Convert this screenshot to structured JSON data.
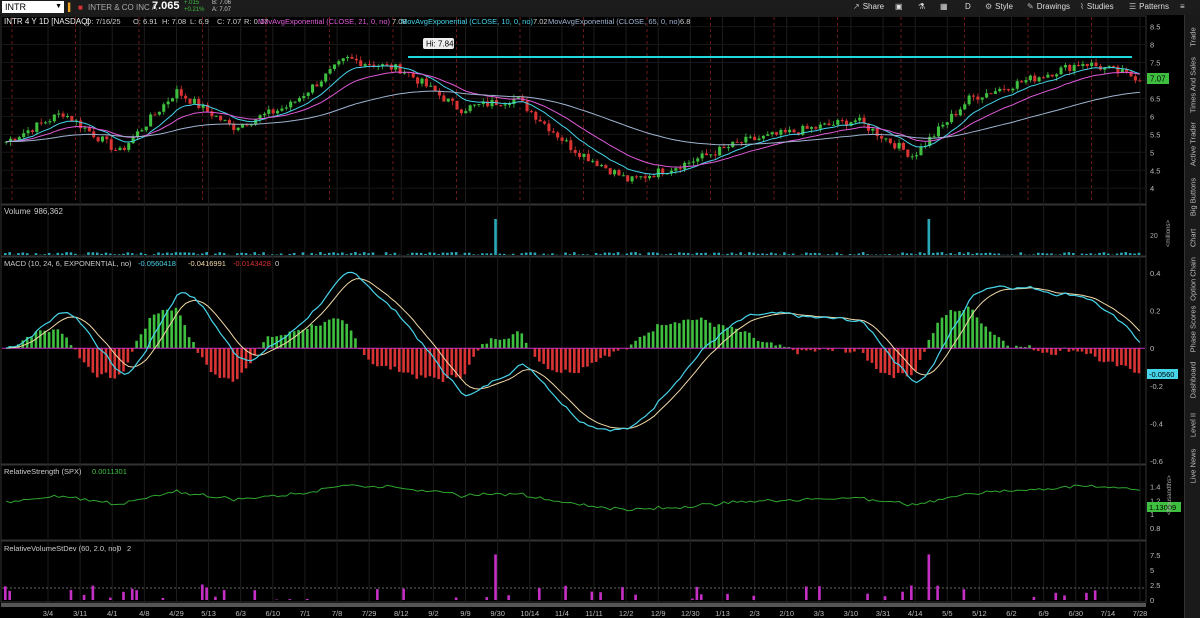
{
  "toolbar": {
    "symbol": "INTR",
    "company": "INTER & CO INC A",
    "last": "7.065",
    "change": "+.015",
    "change_pct": "+0.21%",
    "bid": "B: 7.06",
    "ask": "A: 7.07",
    "share": "Share",
    "aggregation": "D",
    "style": "Style",
    "drawings": "Drawings",
    "studies": "Studies",
    "patterns": "Patterns"
  },
  "header": {
    "title": "INTR 4 Y 1D [NASDAQ]",
    "ohlc": [
      "D: 7/16/25",
      "O: 6.91",
      "H: 7.08",
      "L: 6.9",
      "C: 7.07",
      "R: 0.17"
    ],
    "studies": [
      {
        "label": "MovAvgExponential (CLOSE, 21, 0, no)",
        "value": "7.08",
        "color": "#e05ad9"
      },
      {
        "label": "MovAvgExponential (CLOSE, 10, 0, no)",
        "value": "7.02",
        "color": "#46d4ea"
      },
      {
        "label": "MovAvgExponential (CLOSE, 65, 0, no)",
        "value": "6.8",
        "color": "#9fb3d1"
      }
    ]
  },
  "price_panel": {
    "hi_label": "Hi: 7.84",
    "last_tag": "7.07",
    "yticks": [
      "8.5",
      "8",
      "7.5",
      "7",
      "6.5",
      "6",
      "5.5",
      "5",
      "4.5",
      "4"
    ]
  },
  "volume_panel": {
    "label": "Volume",
    "value": "986,362",
    "ytick": "20",
    "unit": "<millions>"
  },
  "macd_panel": {
    "label": "MACD (10, 24, 6, EXPONENTIAL, no)",
    "v1": "-0.0560418",
    "v2": "-0.0416991",
    "v3": "-0.0143428",
    "v4": "0",
    "last_tag": "-0.0560",
    "yticks": [
      "0.4",
      "0.2",
      "0",
      "-0.2",
      "-0.4",
      "-0.6"
    ]
  },
  "rs_panel": {
    "label": "RelativeStrength (SPX)",
    "value": "0.0011301",
    "last_tag": "1.13009",
    "unit": "<thousandths>",
    "yticks": [
      "1.4",
      "1.2",
      "1",
      "0.8"
    ]
  },
  "rv_panel": {
    "label": "RelativeVolumeStDev (60, 2.0, no)",
    "v1": "0",
    "v2": "2",
    "yticks": [
      "7.5",
      "5",
      "2.5",
      "0"
    ]
  },
  "x_axis": [
    "3/4",
    "3/11",
    "4/1",
    "4/8",
    "4/29",
    "5/13",
    "6/3",
    "6/10",
    "7/1",
    "7/8",
    "7/29",
    "8/12",
    "9/2",
    "9/9",
    "9/30",
    "10/14",
    "11/4",
    "11/11",
    "12/2",
    "12/9",
    "12/30",
    "1/13",
    "2/3",
    "2/10",
    "3/3",
    "3/10",
    "3/31",
    "4/14",
    "5/5",
    "5/12",
    "6/2",
    "6/9",
    "6/30",
    "7/14",
    "7/28"
  ],
  "right_tabs": [
    "Trade",
    "Times And Sales",
    "Active Trader",
    "Big Buttons",
    "Chart",
    "Option Chain",
    "Phase Scores",
    "Dashboard",
    "Level II",
    "Live News"
  ],
  "colors": {
    "up": "#3fbf3f",
    "down": "#d93434",
    "hi_line": "#20d8e0",
    "macd_line": "#46d4ea",
    "macd_signal": "#f2d9a6",
    "zero_line": "#c42fc4",
    "rs_line": "#2fa62f",
    "rv_bar": "#c42fc4",
    "last_tag": "#3fbf3f"
  },
  "chart_data": {
    "type": "candlestick",
    "ylim": [
      3.7,
      8.6
    ],
    "key_levels": {
      "high": 7.84,
      "last_close": 7.07
    },
    "ema_values": {
      "ema21": 7.08,
      "ema10": 7.02,
      "ema65": 6.8
    },
    "trend_anchor_closes": [
      5.3,
      6.1,
      5.0,
      6.7,
      5.7,
      6.3,
      7.6,
      7.3,
      6.2,
      6.5,
      5.1,
      4.2,
      4.7,
      5.3,
      5.6,
      5.9,
      4.9,
      6.5,
      7.0,
      7.5,
      7.07
    ]
  }
}
